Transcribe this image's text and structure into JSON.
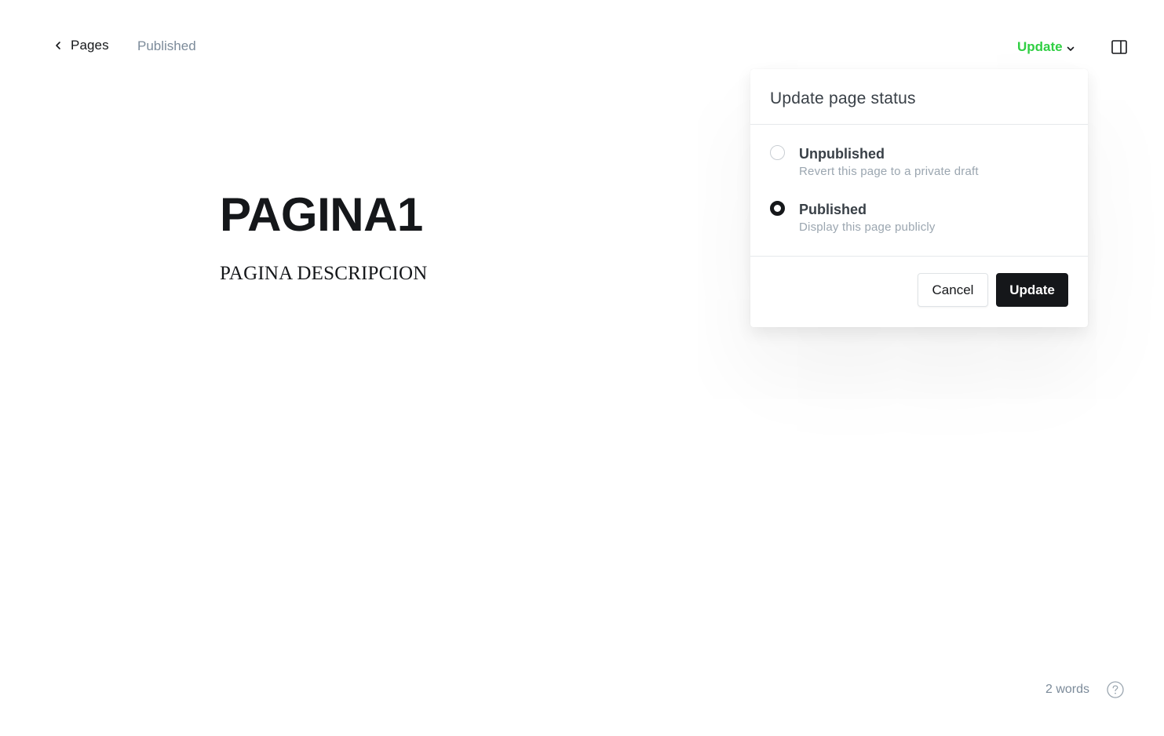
{
  "header": {
    "back_label": "Pages",
    "post_status": "Published",
    "update_trigger_label": "Update",
    "icons": {
      "back": "chevron-left-icon",
      "update_caret": "chevron-down-icon",
      "settings": "sidebar-toggle-icon"
    }
  },
  "editor": {
    "title": "PAGINA1",
    "body": "PAGINA DESCRIPCION"
  },
  "status_popover": {
    "heading": "Update page status",
    "options": [
      {
        "label": "Unpublished",
        "description": "Revert this page to a private draft",
        "selected": false
      },
      {
        "label": "Published",
        "description": "Display this page publicly",
        "selected": true
      }
    ],
    "cancel_label": "Cancel",
    "confirm_label": "Update"
  },
  "footer": {
    "word_count": "2 words",
    "help_icon": "question-circle-icon"
  },
  "colors": {
    "accent_green": "#30cf43",
    "primary_button": "#15171a",
    "muted_text": "#7c8b9a"
  }
}
